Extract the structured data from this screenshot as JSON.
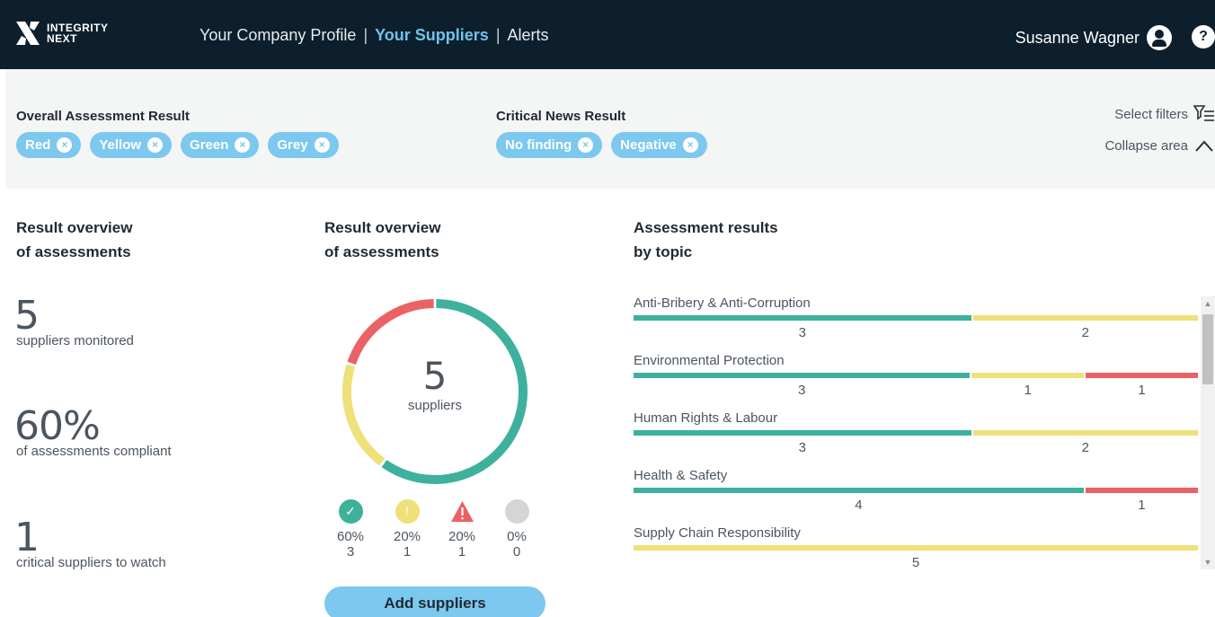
{
  "header": {
    "logo_line1": "INTEGRITY",
    "logo_line2": "NEXT",
    "nav": [
      {
        "label": "Your Company Profile",
        "active": false
      },
      {
        "label": "Your Suppliers",
        "active": true
      },
      {
        "label": "Alerts",
        "active": false
      }
    ],
    "separator": "|",
    "user_name": "Susanne Wagner",
    "help_label": "?"
  },
  "filters": {
    "assessment_title": "Overall Assessment Result",
    "assessment_chips": [
      "Red",
      "Yellow",
      "Green",
      "Grey"
    ],
    "news_title": "Critical News Result",
    "news_chips": [
      "No finding",
      "Negative"
    ],
    "chip_close": "×",
    "select_filters": "Select filters",
    "collapse_area": "Collapse area"
  },
  "overview_left": {
    "title_line1": "Result overview",
    "title_line2": "of assessments",
    "stats": [
      {
        "value": "5",
        "label": "suppliers monitored"
      },
      {
        "value": "60%",
        "label": "of assessments compliant"
      },
      {
        "value": "1",
        "label": "critical suppliers to watch"
      }
    ]
  },
  "overview_middle": {
    "title_line1": "Result overview",
    "title_line2": "of assessments",
    "center_value": "5",
    "center_label": "suppliers",
    "legend": [
      {
        "status": "compliant",
        "icon": "check-icon",
        "percent": "60%",
        "count": "3",
        "color": "#3eb19c"
      },
      {
        "status": "warning",
        "icon": "exclamation-icon",
        "percent": "20%",
        "count": "1",
        "color": "#efe07a"
      },
      {
        "status": "critical",
        "icon": "warning-triangle-icon",
        "percent": "20%",
        "count": "1",
        "color": "#ea6264"
      },
      {
        "status": "unknown",
        "icon": "grey-circle-icon",
        "percent": "0%",
        "count": "0",
        "color": "#d5d5d5"
      }
    ],
    "add_button": "Add suppliers"
  },
  "chart_data": {
    "type": "pie",
    "categories": [
      "Green",
      "Yellow",
      "Red",
      "Grey"
    ],
    "values": [
      3,
      1,
      1,
      0
    ],
    "colors": [
      "#3eb19c",
      "#efe07a",
      "#ea6264",
      "#d5d5d5"
    ]
  },
  "topics_section": {
    "title_line1": "Assessment results",
    "title_line2": "by topic",
    "topics": [
      {
        "name": "Anti-Bribery & Anti-Corruption",
        "green": 3,
        "yellow": 2,
        "red": 0
      },
      {
        "name": "Environmental Protection",
        "green": 3,
        "yellow": 1,
        "red": 1
      },
      {
        "name": "Human Rights & Labour",
        "green": 3,
        "yellow": 2,
        "red": 0
      },
      {
        "name": "Health & Safety",
        "green": 4,
        "yellow": 0,
        "red": 1
      },
      {
        "name": "Supply Chain Responsibility",
        "green": 0,
        "yellow": 5,
        "red": 0
      }
    ]
  },
  "colors": {
    "green": "#3eb19c",
    "yellow": "#efe07a",
    "red": "#ea6264",
    "chip": "#7cc8ef",
    "navy": "#0d1f2d"
  }
}
